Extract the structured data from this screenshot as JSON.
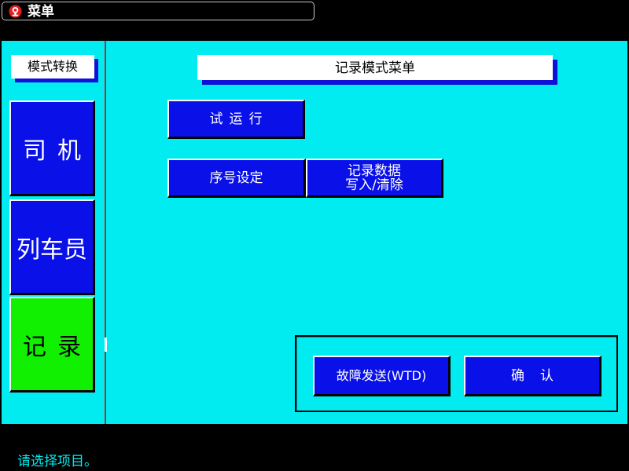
{
  "window": {
    "title": "菜单",
    "logo_icon": "railway-logo-icon"
  },
  "sidebar": {
    "header": "模式转换",
    "items": [
      {
        "label": "司机"
      },
      {
        "label": "列车员"
      },
      {
        "label": "记录"
      }
    ]
  },
  "main": {
    "header": "记录模式菜单",
    "buttons": {
      "trial_run": "试运行",
      "sequence_setting": "序号设定",
      "record_data_line1": "记录数据",
      "record_data_line2": "写入/清除",
      "fault_send": "故障发送(WTD)",
      "confirm": "确认"
    }
  },
  "status": {
    "message": "请选择项目。"
  },
  "colors": {
    "panel": "#00ecf0",
    "button_blue": "#0a10e8",
    "active_green": "#10f000",
    "shadow_blue": "#1010d8",
    "divider": "#b03030"
  }
}
